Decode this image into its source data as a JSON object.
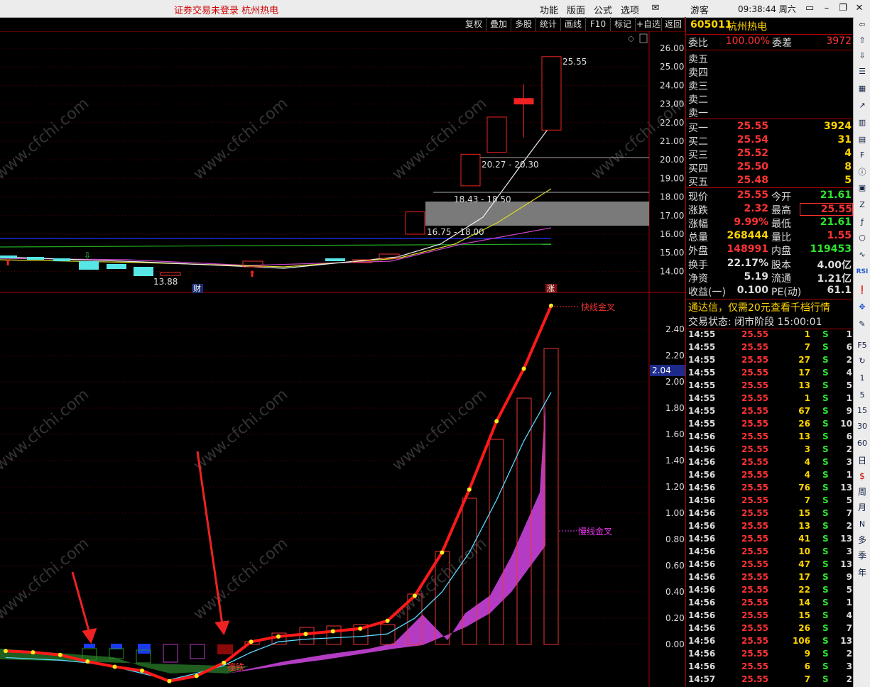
{
  "top_bar": {
    "status": "证券交易未登录  杭州热电",
    "menus": [
      "功能",
      "版面",
      "公式",
      "选项"
    ],
    "user": "游客",
    "time": "09:38:44 周六"
  },
  "toolbar": [
    "复权",
    "叠加",
    "多股",
    "统计",
    "画线",
    "F10",
    "标记",
    "+自选",
    "返回"
  ],
  "stock": {
    "code": "605011",
    "name": "杭州热电"
  },
  "quote": {
    "webi_label": "委比",
    "webi": "100.00%",
    "weicha_label": "委差",
    "weicha": "3972",
    "sells": [
      {
        "label": "卖五",
        "price": "",
        "vol": ""
      },
      {
        "label": "卖四",
        "price": "",
        "vol": ""
      },
      {
        "label": "卖三",
        "price": "",
        "vol": ""
      },
      {
        "label": "卖二",
        "price": "",
        "vol": ""
      },
      {
        "label": "卖一",
        "price": "",
        "vol": ""
      }
    ],
    "buys": [
      {
        "label": "买一",
        "price": "25.55",
        "vol": "3924"
      },
      {
        "label": "买二",
        "price": "25.54",
        "vol": "31"
      },
      {
        "label": "买三",
        "price": "25.52",
        "vol": "4"
      },
      {
        "label": "买四",
        "price": "25.50",
        "vol": "8"
      },
      {
        "label": "买五",
        "price": "25.48",
        "vol": "5"
      }
    ],
    "stats": [
      {
        "l1": "现价",
        "v1": "25.55",
        "l2": "今开",
        "v2": "21.61"
      },
      {
        "l1": "涨跌",
        "v1": "2.32",
        "l2": "最高",
        "v2": "25.55"
      },
      {
        "l1": "涨幅",
        "v1": "9.99%",
        "l2": "最低",
        "v2": "21.61"
      },
      {
        "l1": "总量",
        "v1": "268444",
        "l2": "量比",
        "v2": "1.55"
      },
      {
        "l1": "外盘",
        "v1": "148991",
        "l2": "内盘",
        "v2": "119453"
      },
      {
        "l1": "换手",
        "v1": "22.17%",
        "l2": "股本",
        "v2": "4.00亿"
      },
      {
        "l1": "净资",
        "v1": "5.19",
        "l2": "流通",
        "v2": "1.21亿"
      },
      {
        "l1": "收益(一)",
        "v1": "0.100",
        "l2": "PE(动)",
        "v2": "61.1"
      }
    ],
    "ad_text": "通达信，仅需20元查看千档行情",
    "trade_status": "交易状态: 闭市阶段 15:00:01",
    "ticks": [
      {
        "t": "14:55",
        "p": "25.55",
        "v": "1",
        "s": "S",
        "n": "1"
      },
      {
        "t": "14:55",
        "p": "25.55",
        "v": "7",
        "s": "S",
        "n": "6"
      },
      {
        "t": "14:55",
        "p": "25.55",
        "v": "27",
        "s": "S",
        "n": "2"
      },
      {
        "t": "14:55",
        "p": "25.55",
        "v": "17",
        "s": "S",
        "n": "4"
      },
      {
        "t": "14:55",
        "p": "25.55",
        "v": "13",
        "s": "S",
        "n": "5"
      },
      {
        "t": "14:55",
        "p": "25.55",
        "v": "1",
        "s": "S",
        "n": "1"
      },
      {
        "t": "14:55",
        "p": "25.55",
        "v": "67",
        "s": "S",
        "n": "9"
      },
      {
        "t": "14:55",
        "p": "25.55",
        "v": "26",
        "s": "S",
        "n": "10"
      },
      {
        "t": "14:56",
        "p": "25.55",
        "v": "13",
        "s": "S",
        "n": "6"
      },
      {
        "t": "14:56",
        "p": "25.55",
        "v": "3",
        "s": "S",
        "n": "2"
      },
      {
        "t": "14:56",
        "p": "25.55",
        "v": "4",
        "s": "S",
        "n": "3"
      },
      {
        "t": "14:56",
        "p": "25.55",
        "v": "4",
        "s": "S",
        "n": "1"
      },
      {
        "t": "14:56",
        "p": "25.55",
        "v": "76",
        "s": "S",
        "n": "13"
      },
      {
        "t": "14:56",
        "p": "25.55",
        "v": "7",
        "s": "S",
        "n": "5"
      },
      {
        "t": "14:56",
        "p": "25.55",
        "v": "15",
        "s": "S",
        "n": "7"
      },
      {
        "t": "14:56",
        "p": "25.55",
        "v": "13",
        "s": "S",
        "n": "2"
      },
      {
        "t": "14:56",
        "p": "25.55",
        "v": "41",
        "s": "S",
        "n": "13"
      },
      {
        "t": "14:56",
        "p": "25.55",
        "v": "10",
        "s": "S",
        "n": "3"
      },
      {
        "t": "14:56",
        "p": "25.55",
        "v": "47",
        "s": "S",
        "n": "13"
      },
      {
        "t": "14:56",
        "p": "25.55",
        "v": "17",
        "s": "S",
        "n": "9"
      },
      {
        "t": "14:56",
        "p": "25.55",
        "v": "22",
        "s": "S",
        "n": "5"
      },
      {
        "t": "14:56",
        "p": "25.55",
        "v": "14",
        "s": "S",
        "n": "1"
      },
      {
        "t": "14:56",
        "p": "25.55",
        "v": "15",
        "s": "S",
        "n": "4"
      },
      {
        "t": "14:56",
        "p": "25.55",
        "v": "26",
        "s": "S",
        "n": "7"
      },
      {
        "t": "14:56",
        "p": "25.55",
        "v": "106",
        "s": "S",
        "n": "13"
      },
      {
        "t": "14:56",
        "p": "25.55",
        "v": "9",
        "s": "S",
        "n": "2"
      },
      {
        "t": "14:56",
        "p": "25.55",
        "v": "6",
        "s": "S",
        "n": "3"
      },
      {
        "t": "14:57",
        "p": "25.55",
        "v": "7",
        "s": "S",
        "n": "2"
      }
    ]
  },
  "sidebar_items": [
    "5",
    "15",
    "30",
    "60",
    "日",
    "周",
    "月",
    "N",
    "多",
    "季",
    "年"
  ],
  "chart_data": [
    {
      "type": "candlestick",
      "ylim": [
        13.6,
        26.4
      ],
      "yticks": [
        "26.00",
        "25.00",
        "24.00",
        "23.00",
        "22.00",
        "21.00",
        "20.00",
        "19.00",
        "18.00",
        "17.00",
        "16.00",
        "15.00",
        "14.00"
      ],
      "annotations": [
        "25.55",
        "20.27 - 20.30",
        "18.43 - 18.50",
        "16.75 - 18.00",
        "13.88",
        "财",
        "涨"
      ],
      "candles": [
        {
          "o": 16.0,
          "c": 17.2,
          "h": 17.2,
          "l": 16.0
        },
        {
          "o": 18.6,
          "c": 20.3,
          "h": 20.3,
          "l": 18.6
        },
        {
          "o": 20.4,
          "c": 22.3,
          "h": 22.3,
          "l": 20.4
        },
        {
          "o": 23.3,
          "c": 23.0,
          "h": 24.05,
          "l": 21.2
        },
        {
          "o": 21.6,
          "c": 25.55,
          "h": 25.55,
          "l": 21.6
        }
      ]
    },
    {
      "type": "line",
      "ylim": [
        -0.3,
        2.6
      ],
      "yticks": [
        "2.40",
        "2.20",
        "2.00",
        "1.80",
        "1.60",
        "1.40",
        "1.20",
        "1.00",
        "0.80",
        "0.60",
        "0.40",
        "0.20",
        "0.00"
      ],
      "cursor_value": "2.04",
      "annotations": [
        "快线金叉",
        "慢线金叉",
        "撞铁"
      ],
      "series": [
        {
          "values": [
            -0.05,
            -0.06,
            -0.08,
            -0.13,
            -0.17,
            -0.2,
            -0.28,
            -0.24,
            -0.14,
            0.02,
            0.06,
            0.08,
            0.1,
            0.12,
            0.18,
            0.37,
            0.7,
            1.18,
            1.7,
            2.1,
            2.58
          ]
        },
        {
          "values": [
            -0.1,
            -0.11,
            -0.12,
            -0.14,
            -0.17,
            -0.22,
            -0.27,
            -0.22,
            -0.16,
            -0.06,
            0.02,
            0.04,
            0.05,
            0.06,
            0.08,
            0.2,
            0.4,
            0.7,
            1.1,
            1.55,
            1.92
          ]
        }
      ]
    }
  ]
}
